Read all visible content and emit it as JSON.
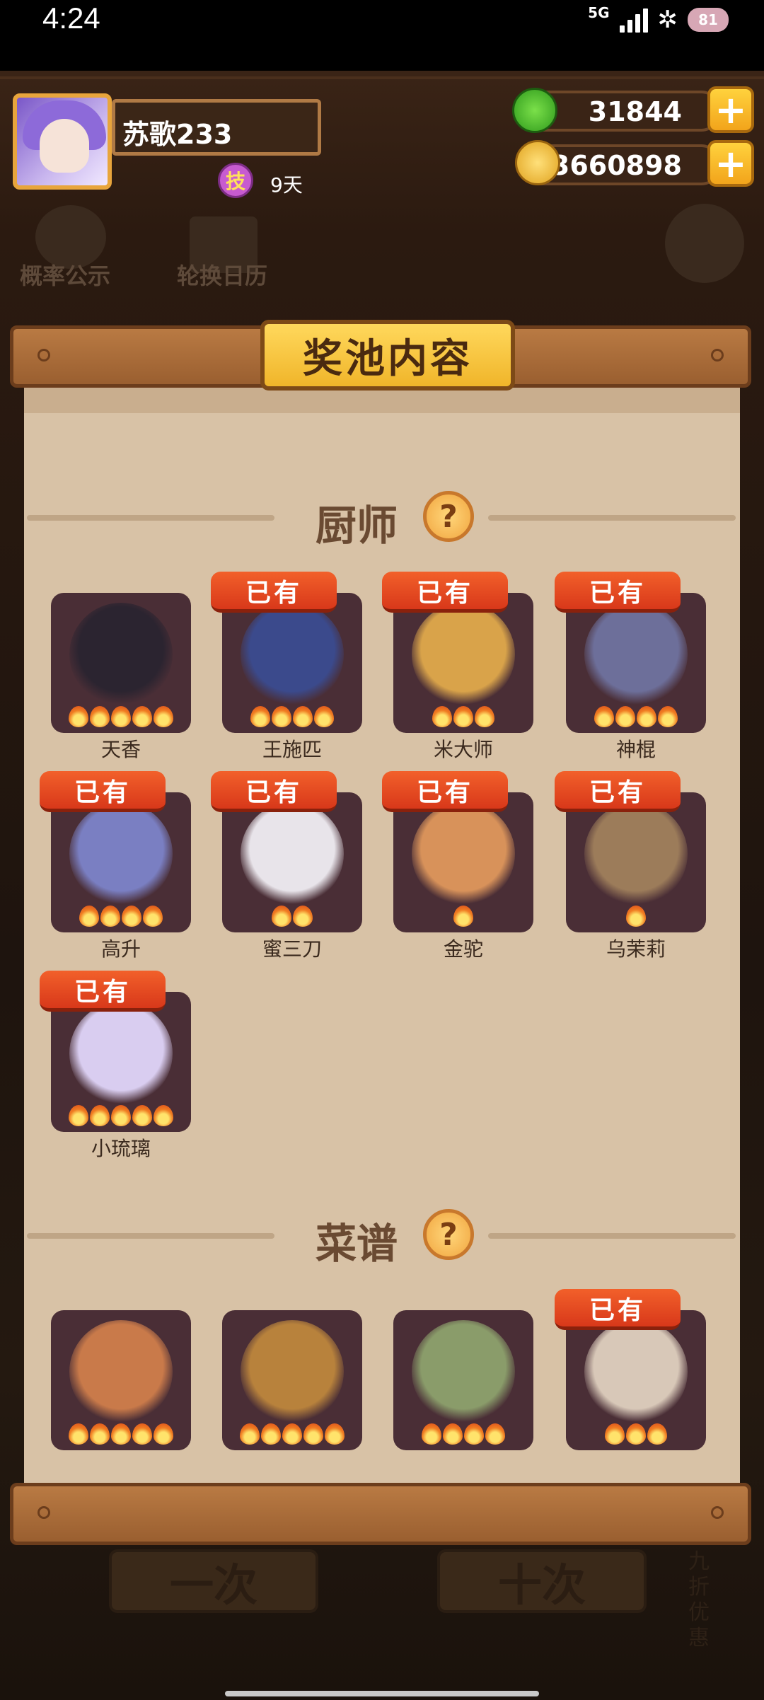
{
  "status_bar": {
    "time": "4:24",
    "network": "5G",
    "battery": "81"
  },
  "header": {
    "player_name": "苏歌233",
    "skill_badge": "技",
    "skill_days": "9天",
    "currency_jade": "31844",
    "currency_coins": "73660898"
  },
  "background": {
    "btn_probability": "概率公示",
    "btn_calendar": "轮换日历",
    "btn_single": "一次",
    "btn_ten": "十次",
    "side_promo": "九折优惠"
  },
  "modal": {
    "title": "奖池内容",
    "chef_section": "厨师",
    "recipe_section": "菜谱",
    "owned_label": "已有",
    "help_glyph": "?"
  },
  "chefs": [
    {
      "name": "天香",
      "stars": 5,
      "owned": false,
      "color": "#2b2430"
    },
    {
      "name": "王施匹",
      "stars": 4,
      "owned": true,
      "color": "#3b4a8c"
    },
    {
      "name": "米大师",
      "stars": 3,
      "owned": true,
      "color": "#d9a34a"
    },
    {
      "name": "神棍",
      "stars": 4,
      "owned": true,
      "color": "#6d6f9a"
    },
    {
      "name": "高升",
      "stars": 4,
      "owned": true,
      "color": "#7a7fc2"
    },
    {
      "name": "蜜三刀",
      "stars": 2,
      "owned": true,
      "color": "#e8e4ea"
    },
    {
      "name": "金驼",
      "stars": 1,
      "owned": true,
      "color": "#d8925a"
    },
    {
      "name": "乌茉莉",
      "stars": 1,
      "owned": true,
      "color": "#9c7c5a"
    },
    {
      "name": "小琉璃",
      "stars": 5,
      "owned": true,
      "color": "#d9cdf0"
    }
  ],
  "recipes": [
    {
      "stars": 5,
      "owned": false,
      "color": "#c97a4a"
    },
    {
      "stars": 5,
      "owned": false,
      "color": "#b8823c"
    },
    {
      "stars": 4,
      "owned": false,
      "color": "#8a9c6a"
    },
    {
      "stars": 3,
      "owned": true,
      "color": "#d8c8b8"
    }
  ],
  "colors": {
    "accent_orange": "#e0461f",
    "gold": "#f0b52a",
    "paper": "#d8c2a6",
    "card": "#4a2e36"
  }
}
